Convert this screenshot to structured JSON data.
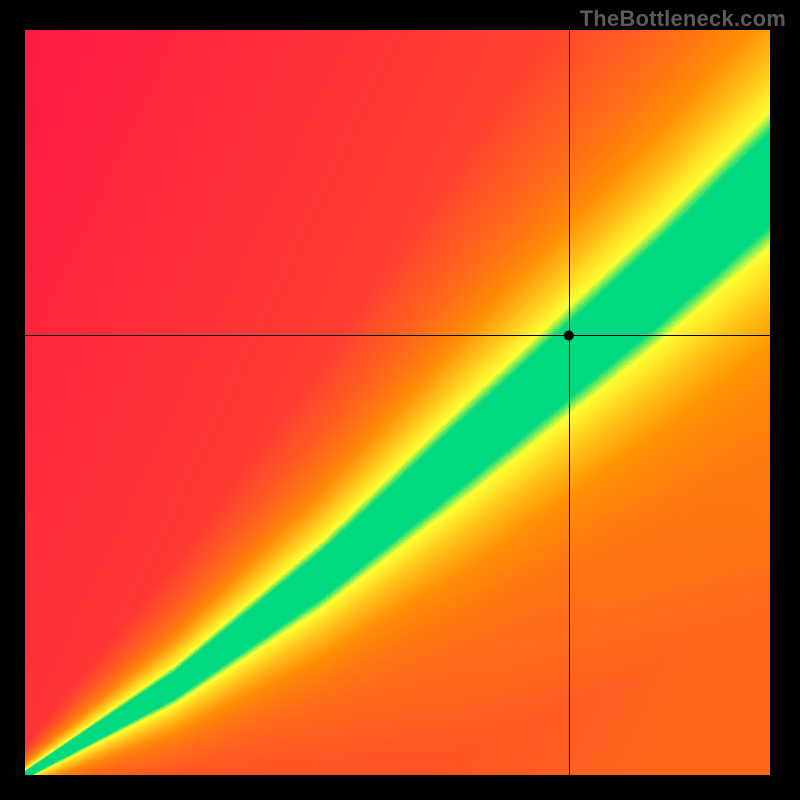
{
  "brand": "TheBottleneck.com",
  "chart_data": {
    "type": "heatmap",
    "title": "",
    "xlabel": "",
    "ylabel": "",
    "xlim": [
      0,
      1
    ],
    "ylim": [
      0,
      1
    ],
    "crosshair": {
      "x": 0.73,
      "y": 0.59
    },
    "dot_radius_px": 5,
    "description": "Bottleneck heatmap: diagonal green band indicates balanced pairing; regions away from the diagonal grade through yellow/orange to red indicating bottleneck. A black crosshair marks the queried configuration point.",
    "color_stops": {
      "red": "#ff1a44",
      "orange": "#ff9a00",
      "yellow": "#ffff33",
      "green": "#00d97f"
    },
    "green_band": {
      "note": "Approximate centerline and half-width of the optimal (green) band, in normalized [0,1] coords with origin at bottom-left.",
      "centerline": [
        {
          "x": 0.0,
          "y": 0.0
        },
        {
          "x": 0.2,
          "y": 0.12
        },
        {
          "x": 0.4,
          "y": 0.27
        },
        {
          "x": 0.55,
          "y": 0.4
        },
        {
          "x": 0.7,
          "y": 0.53
        },
        {
          "x": 0.85,
          "y": 0.66
        },
        {
          "x": 1.0,
          "y": 0.8
        }
      ],
      "half_width_y": [
        {
          "x": 0.0,
          "w": 0.005
        },
        {
          "x": 0.2,
          "w": 0.02
        },
        {
          "x": 0.4,
          "w": 0.035
        },
        {
          "x": 0.6,
          "w": 0.05
        },
        {
          "x": 0.8,
          "w": 0.06
        },
        {
          "x": 1.0,
          "w": 0.07
        }
      ]
    }
  }
}
